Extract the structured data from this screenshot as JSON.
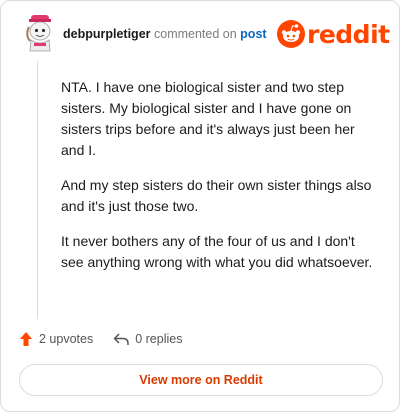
{
  "comment": {
    "username": "debpurpletiger",
    "action_text": "commented on",
    "target_link": "post",
    "paragraphs": [
      "NTA. I have one biological sister and two step sisters. My biological sister and I have gone on sisters trips before and it's always just been her and I.",
      "And my step sisters do their own sister things also and it's just those two.",
      "It never bothers any of the four of us and I don't see anything wrong with what you did whatsoever."
    ]
  },
  "brand": {
    "name": "reddit",
    "color": "#ff4500",
    "icon": "reddit-alien-logo-icon"
  },
  "actions": {
    "upvotes_label": "2 upvotes",
    "replies_label": "0 replies",
    "upvote_icon": "upvote-arrow-icon",
    "reply_icon": "reply-arrow-icon",
    "upvote_color": "#ff4500"
  },
  "footer": {
    "view_more_label": "View more on Reddit",
    "view_more_color": "#d93a00"
  }
}
